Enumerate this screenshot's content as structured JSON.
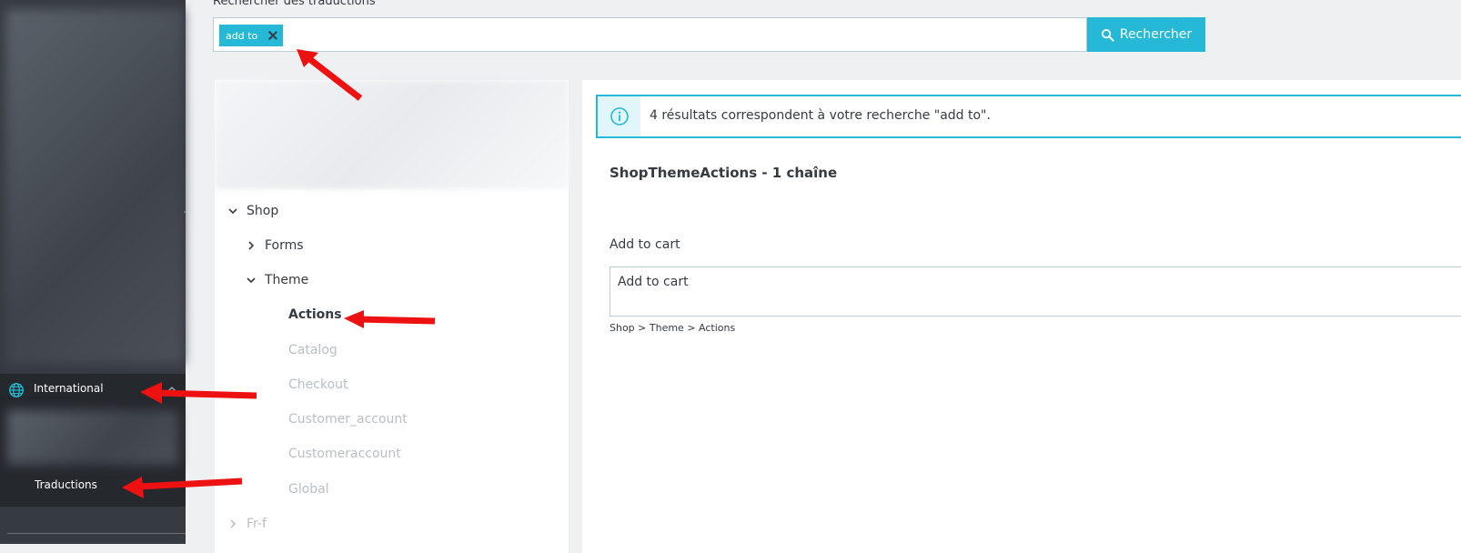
{
  "sidebar": {
    "international_label": "International",
    "translations_label": "Traductions"
  },
  "search": {
    "label": "Rechercher des traductions",
    "tag": "add to",
    "button_label": "Rechercher"
  },
  "tree": {
    "shop": "Shop",
    "forms": "Forms",
    "theme": "Theme",
    "leaves": [
      "Actions",
      "Catalog",
      "Checkout",
      "Customer_account",
      "Customeraccount",
      "Global"
    ],
    "next_root": "Fr-f"
  },
  "results": {
    "info": "4 résultats correspondent à votre recherche \"add to\".",
    "domain_title": "ShopThemeActions - 1 chaîne",
    "source_text": "Add to cart",
    "translation_value": "Add to cart",
    "path": "Shop > Theme > Actions"
  },
  "colors": {
    "accent": "#25b9d7",
    "sidebar": "#363a41",
    "annotation_arrow": "#ee1111"
  }
}
